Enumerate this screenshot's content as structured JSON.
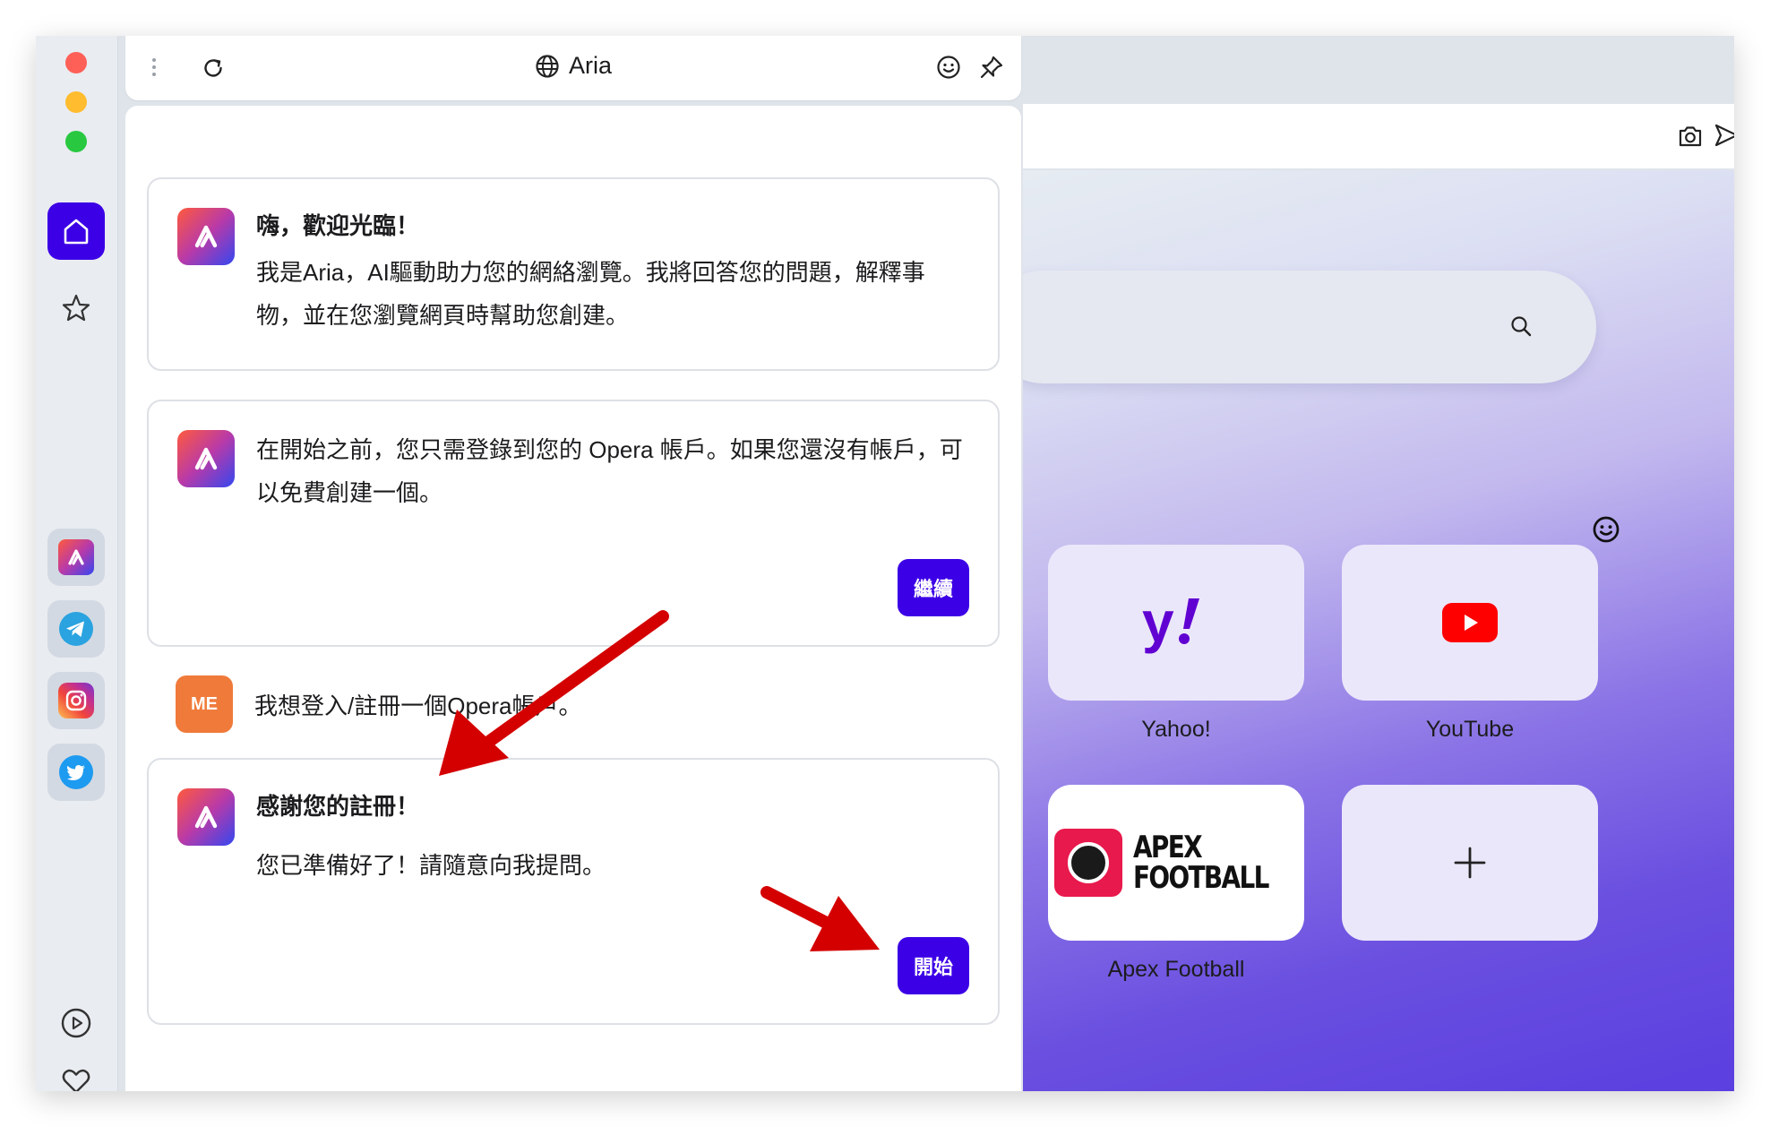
{
  "window": {
    "traffic_lights": [
      "close",
      "minimize",
      "zoom"
    ]
  },
  "sidebar": {
    "items": [
      {
        "name": "home",
        "icon": "home-icon",
        "active": true
      },
      {
        "name": "speed-dial",
        "icon": "star-icon"
      },
      {
        "name": "aria",
        "icon": "aria-icon"
      },
      {
        "name": "telegram",
        "icon": "telegram-icon"
      },
      {
        "name": "instagram",
        "icon": "instagram-icon"
      },
      {
        "name": "twitter",
        "icon": "twitter-icon"
      },
      {
        "name": "player",
        "icon": "play-icon"
      },
      {
        "name": "favorites",
        "icon": "heart-icon"
      }
    ]
  },
  "panel": {
    "title": "Aria",
    "accent_color": "#3c00e6"
  },
  "chat": {
    "messages": [
      {
        "sender": "aria",
        "title": "嗨，歡迎光臨！",
        "text": "我是Aria，AI驅動助力您的網絡瀏覽。我將回答您的問題，解釋事物，並在您瀏覽網頁時幫助您創建。"
      },
      {
        "sender": "aria",
        "text": "在開始之前，您只需登錄到您的 Opera 帳戶。如果您還沒有帳戶，可以免費創建一個。",
        "button": "繼續"
      },
      {
        "sender": "user",
        "avatar_label": "ME",
        "text": "我想登入/註冊一個Opera帳戶。"
      },
      {
        "sender": "aria",
        "title": "感謝您的註冊！",
        "text": "您已準備好了！請隨意向我提問。",
        "button": "開始"
      }
    ]
  },
  "speed_dial": {
    "tiles": [
      {
        "label": "Yahoo!",
        "icon": "yahoo-icon"
      },
      {
        "label": "YouTube",
        "icon": "youtube-icon"
      },
      {
        "label": "Apex Football",
        "icon": "apex-football-logo",
        "logo_text": "APEX FOOTBALL"
      },
      {
        "label": "",
        "icon": "plus-icon"
      }
    ]
  }
}
